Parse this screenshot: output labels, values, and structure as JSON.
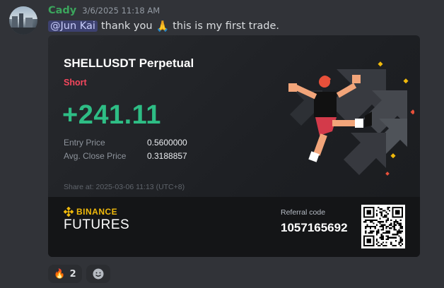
{
  "message": {
    "author": "Cady",
    "timestamp": "3/6/2025 11:18 AM",
    "mention": "@Jun Kai",
    "text_before_emoji": "thank you",
    "emoji": "🙏",
    "text_after_emoji": "this is my first trade.",
    "author_color": "#3ba55c"
  },
  "card": {
    "title": "SHELLUSDT Perpetual",
    "side": "Short",
    "pnl": "+241.11",
    "entry_label": "Entry Price",
    "entry_value": "0.5600000",
    "close_label": "Avg. Close Price",
    "close_value": "0.3188857",
    "share_text": "Share at: 2025-03-06 11:13 (UTC+8)",
    "brand_top": "BINANCE",
    "brand_bottom": "FUTURES",
    "referral_label": "Referral code",
    "referral_code": "1057165692",
    "pnl_color": "#2ebd85",
    "short_color": "#f6465d",
    "brand_color": "#f0b90b"
  },
  "reactions": [
    {
      "emoji": "🔥",
      "count": "2",
      "icon": "fire-icon"
    }
  ],
  "add_reaction_icon": "smiley-add-icon"
}
